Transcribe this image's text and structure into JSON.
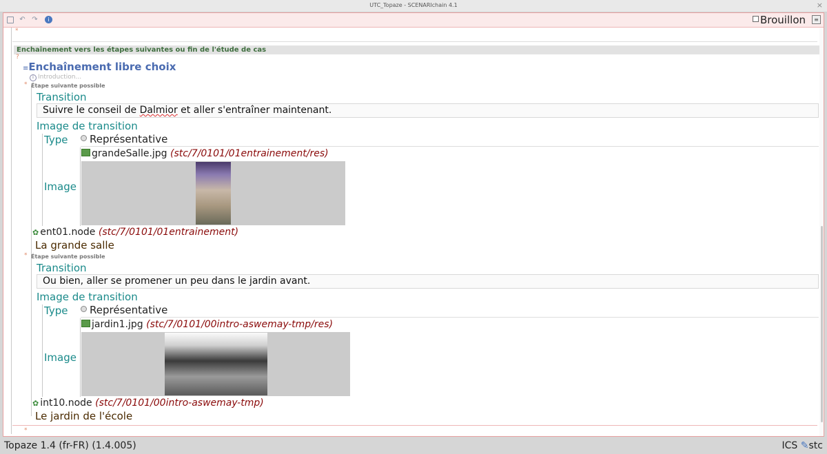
{
  "window": {
    "title": "UTC_Topaze - SCENARIchain 4.1",
    "close_glyph": "×"
  },
  "toolbar": {
    "draft_label": "Brouillon"
  },
  "section": {
    "title": "Enchaînement vers les étapes suivantes ou fin de l'étude de cas"
  },
  "block": {
    "title": "Enchaînement libre choix",
    "intro": "Introduction...",
    "steps": [
      {
        "caption": "Étape suivante possible",
        "transition_label": "Transition",
        "transition_text_a": "Suivre le conseil de ",
        "transition_text_b": "Dalmior",
        "transition_text_c": " et aller s'entraîner maintenant.",
        "image_section_label": "Image de transition",
        "type_label": "Type",
        "type_value": "Représentative",
        "file_name": "grandeSalle.jpg",
        "file_path": "(stc/7/0101/01entrainement/res)",
        "image_label": "Image",
        "node_name": "ent01.node",
        "node_path": "(stc/7/0101/01entrainement)",
        "node_title": "La grande salle"
      },
      {
        "caption": "Étape suivante possible",
        "transition_label": "Transition",
        "transition_text": "Ou bien, aller se promener un peu dans le jardin avant.",
        "image_section_label": "Image de transition",
        "type_label": "Type",
        "type_value": "Représentative",
        "file_name": "jardin1.jpg",
        "file_path": "(stc/7/0101/00intro-aswemay-tmp/res)",
        "image_label": "Image",
        "node_name": "int10.node",
        "node_path": "(stc/7/0101/00intro-aswemay-tmp)",
        "node_title": "Le jardin de l'école"
      }
    ]
  },
  "status": {
    "left": "Topaze 1.4 (fr-FR) (1.4.005)",
    "right_a": "ICS",
    "right_b": "stc"
  },
  "colors": {
    "accent": "#4a6bb0",
    "teal": "#1a8a8a",
    "path_red": "#8a0a0a",
    "border_pink": "#e8a0a0"
  },
  "icons": [
    "save-icon",
    "undo-icon",
    "redo-icon",
    "info-icon",
    "menu-icon",
    "image-file-icon",
    "node-icon",
    "pen-icon"
  ]
}
